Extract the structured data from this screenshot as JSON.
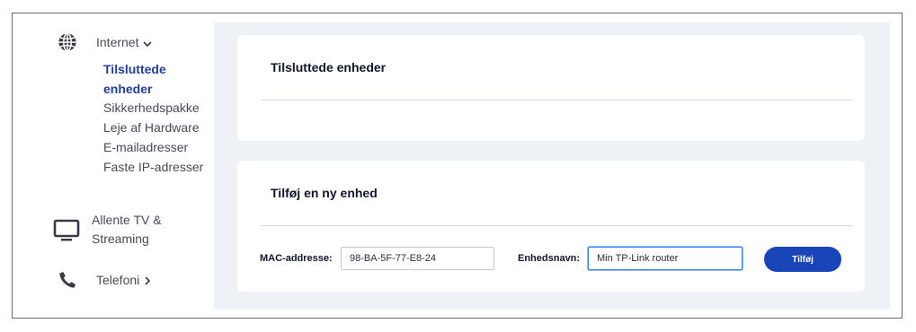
{
  "sidebar": {
    "internet": {
      "label": "Internet",
      "icon": "globe-icon"
    },
    "sub_items": [
      {
        "label": "Tilsluttede enheder",
        "active": true
      },
      {
        "label": "Sikkerhedspakke",
        "active": false
      },
      {
        "label": "Leje af Hardware",
        "active": false
      },
      {
        "label": "E-mailadresser",
        "active": false
      },
      {
        "label": "Faste IP-adresser",
        "active": false
      }
    ],
    "tv": {
      "label_line1": "Allente TV &",
      "label_line2": "Streaming",
      "icon": "monitor-icon"
    },
    "telefoni": {
      "label": "Telefoni",
      "icon": "phone-icon"
    }
  },
  "cards": {
    "connected": {
      "title": "Tilsluttede enheder"
    },
    "add": {
      "title": "Tilføj en ny enhed",
      "mac_label": "MAC-addresse:",
      "mac_value": "98-BA-5F-77-E8-24",
      "name_label": "Enhedsnavn:",
      "name_value": "Min TP-Link router",
      "button_label": "Tilføj"
    }
  },
  "colors": {
    "accent": "#1a45b8",
    "active_link": "#1f3f9e",
    "main_bg": "#eef1f6"
  }
}
